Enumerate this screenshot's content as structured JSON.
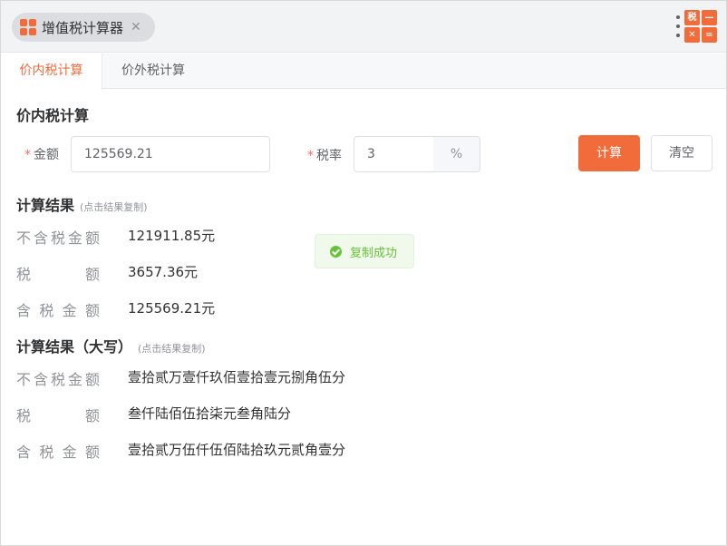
{
  "app": {
    "tab_title": "增值税计算器",
    "close_glyph": "✕",
    "logo_cells": [
      "税",
      "—",
      "✕",
      "="
    ]
  },
  "tabs": [
    {
      "label": "价内税计算",
      "active": true
    },
    {
      "label": "价外税计算",
      "active": false
    }
  ],
  "form": {
    "section_title": "价内税计算",
    "required_mark": "*",
    "amount_label": "金额",
    "amount_value": "125569.21",
    "rate_label": "税率",
    "rate_value": "3",
    "rate_suffix": "%",
    "calc_button": "计算",
    "clear_button": "清空"
  },
  "results": {
    "title": "计算结果",
    "hint": "(点击结果复制)",
    "rows": [
      {
        "label_chars": [
          "不",
          "含",
          "税",
          "金",
          "额"
        ],
        "value": "121911.85元"
      },
      {
        "label_chars": [
          "税",
          "额"
        ],
        "value": "3657.36元"
      },
      {
        "label_chars": [
          "含",
          "税",
          "金",
          "额"
        ],
        "value": "125569.21元"
      }
    ]
  },
  "results_upper": {
    "title": "计算结果（大写）",
    "hint": "(点击结果复制)",
    "rows": [
      {
        "label_chars": [
          "不",
          "含",
          "税",
          "金",
          "额"
        ],
        "value": "壹拾贰万壹仟玖佰壹拾壹元捌角伍分"
      },
      {
        "label_chars": [
          "税",
          "额"
        ],
        "value": "叁仟陆佰伍拾柒元叁角陆分"
      },
      {
        "label_chars": [
          "含",
          "税",
          "金",
          "额"
        ],
        "value": "壹拾贰万伍仟伍佰陆拾玖元贰角壹分"
      }
    ]
  },
  "toast": {
    "message": "复制成功",
    "color": "#67c23a"
  },
  "colors": {
    "accent": "#f26b3a",
    "required": "#f56c6c"
  }
}
